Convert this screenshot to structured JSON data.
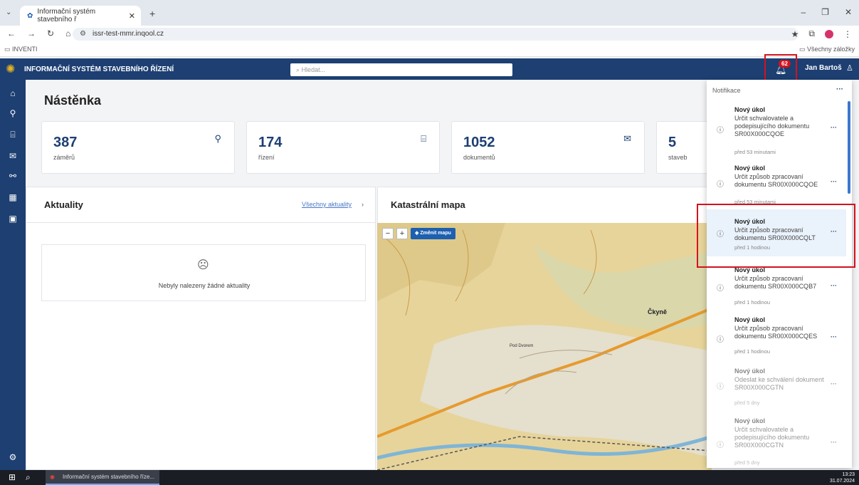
{
  "browser": {
    "tab_title": "Informační systém stavebního ř",
    "url": "issr-test-mmr.inqool.cz",
    "bookmark_left": "INVENTI",
    "bookmark_right": "Všechny záložky"
  },
  "app": {
    "title": "INFORMAČNÍ SYSTÉM STAVEBNÍHO ŘÍZENÍ",
    "search_placeholder": "Hledat...",
    "notif_count": "62",
    "user": "Jan Bartoš"
  },
  "page": {
    "title": "Nástěnka",
    "cards": [
      {
        "value": "387",
        "label": "záměrů",
        "icon": "pin-icon"
      },
      {
        "value": "174",
        "label": "řízení",
        "icon": "building-icon"
      },
      {
        "value": "1052",
        "label": "dokumentů",
        "icon": "mail-icon"
      },
      {
        "value": "5",
        "label": "staveb",
        "icon": "house-icon"
      }
    ],
    "news_title": "Aktuality",
    "news_link": "Všechny aktuality",
    "news_empty": "Nebyly nalezeny žádné aktuality",
    "map_title": "Katastrální mapa",
    "map_change": "Změnit mapu",
    "map_labels": {
      "town": "Čkyně",
      "street": "Pod Dvorem"
    }
  },
  "notifications": {
    "header": "Notifikace",
    "items": [
      {
        "title": "Nový úkol",
        "body": "Určit schvalovatele a podepisujícího dokumentu SR00X000CQOE",
        "time": "před 53 minutami"
      },
      {
        "title": "Nový úkol",
        "body": "Určit způsob zpracovaní dokumentu SR00X000CQOE",
        "time": "před 53 minutami"
      },
      {
        "title": "Nový úkol",
        "body": "Určit způsob zpracovaní dokumentu SR00X000CQLT",
        "time": "před 1 hodinou"
      },
      {
        "title": "Nový úkol",
        "body": "Určit způsob zpracovaní dokumentu SR00X000CQB7",
        "time": "před 1 hodinou"
      },
      {
        "title": "Nový úkol",
        "body": "Určit způsob zpracovaní dokumentu SR00X000CQES",
        "time": "před 1 hodinou"
      },
      {
        "title": "Nový úkol",
        "body": "Odeslat ke schválení dokument SR00X000CGTN",
        "time": "před 5 dny"
      },
      {
        "title": "Nový úkol",
        "body": "Určit schvalovatele a podepisujícího dokumentu SR00X000CGTN",
        "time": "před 5 dny"
      }
    ]
  },
  "taskbar": {
    "app": "Informační systém stavebního říze...",
    "time": "13:23",
    "date": "31.07.2024"
  }
}
